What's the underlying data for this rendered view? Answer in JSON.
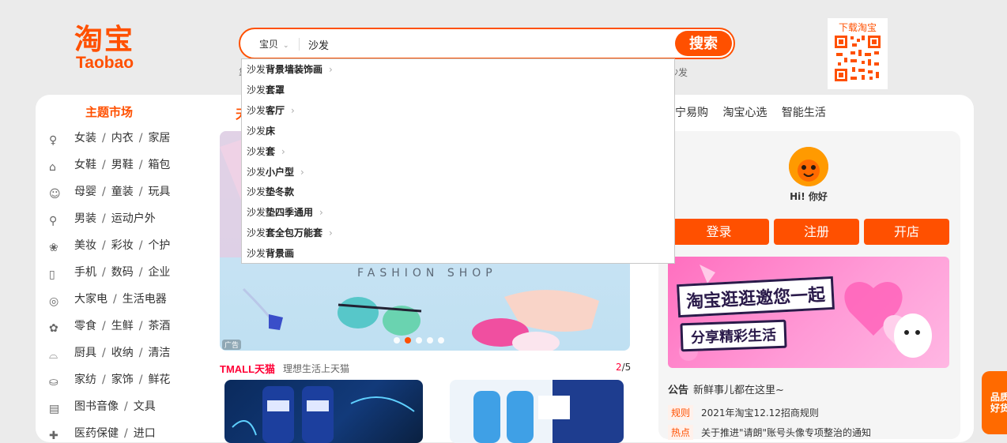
{
  "logo": {
    "cn": "淘宝",
    "en": "Taobao"
  },
  "search": {
    "scope_label": "宝贝",
    "query": "沙发",
    "button_label": "搜索",
    "hot_left": "靠",
    "hot_right": "沙发"
  },
  "qr": {
    "title": "下载淘宝"
  },
  "market": {
    "title": "主题市场",
    "categories": [
      [
        "女装",
        "内衣",
        "家居"
      ],
      [
        "女鞋",
        "男鞋",
        "箱包"
      ],
      [
        "母婴",
        "童装",
        "玩具"
      ],
      [
        "男装",
        "运动户外"
      ],
      [
        "美妆",
        "彩妆",
        "个护"
      ],
      [
        "手机",
        "数码",
        "企业"
      ],
      [
        "大家电",
        "生活电器"
      ],
      [
        "零食",
        "生鲜",
        "茶酒"
      ],
      [
        "厨具",
        "收纳",
        "清洁"
      ],
      [
        "家纺",
        "家饰",
        "鲜花"
      ],
      [
        "图书音像",
        "文具"
      ],
      [
        "医药保健",
        "进口"
      ]
    ]
  },
  "nav": {
    "frag": "天",
    "right": [
      "宁易购",
      "淘宝心选",
      "智能生活"
    ]
  },
  "banner": {
    "text": "FASHION SHOP",
    "ad": "广告",
    "active_dot": 2,
    "dot_count": 5
  },
  "tmall": {
    "logo": "TMALL天猫",
    "slogan": "理想生活上天猫",
    "page_current": "2",
    "page_total": "/5"
  },
  "user": {
    "hello": "Hi! 你好",
    "login": "登录",
    "register": "注册",
    "open_store": "开店"
  },
  "promo": {
    "line1": "淘宝逛逛邀您一起",
    "line2": "分享精彩生活"
  },
  "notices": {
    "label": "公告",
    "text": "新鲜事儿都在这里~",
    "rows": [
      {
        "tag": "规则",
        "text": "2021年淘宝12.12招商规则"
      },
      {
        "tag": "热点",
        "text": "关于推进\"请朗\"账号头像专项整治的通知"
      }
    ]
  },
  "side": {
    "text": "品质好货"
  },
  "suggestions": [
    {
      "prefix": "沙发",
      "rest": "背景墙装饰画",
      "arrow": true
    },
    {
      "prefix": "沙发",
      "rest": "套罩",
      "arrow": false
    },
    {
      "prefix": "沙发",
      "rest": "客厅",
      "arrow": true
    },
    {
      "prefix": "沙发",
      "rest": "床",
      "arrow": false
    },
    {
      "prefix": "沙发",
      "rest": "套",
      "arrow": true
    },
    {
      "prefix": "沙发",
      "rest": "小户型",
      "arrow": true
    },
    {
      "prefix": "沙发",
      "rest": "垫冬款",
      "arrow": false
    },
    {
      "prefix": "沙发",
      "rest": "垫四季通用",
      "arrow": true
    },
    {
      "prefix": "沙发",
      "rest": "套全包万能套",
      "arrow": true
    },
    {
      "prefix": "沙发",
      "rest": "背景画",
      "arrow": false
    }
  ],
  "colors": {
    "brand": "#ff5000",
    "tmall": "#ff0036"
  }
}
